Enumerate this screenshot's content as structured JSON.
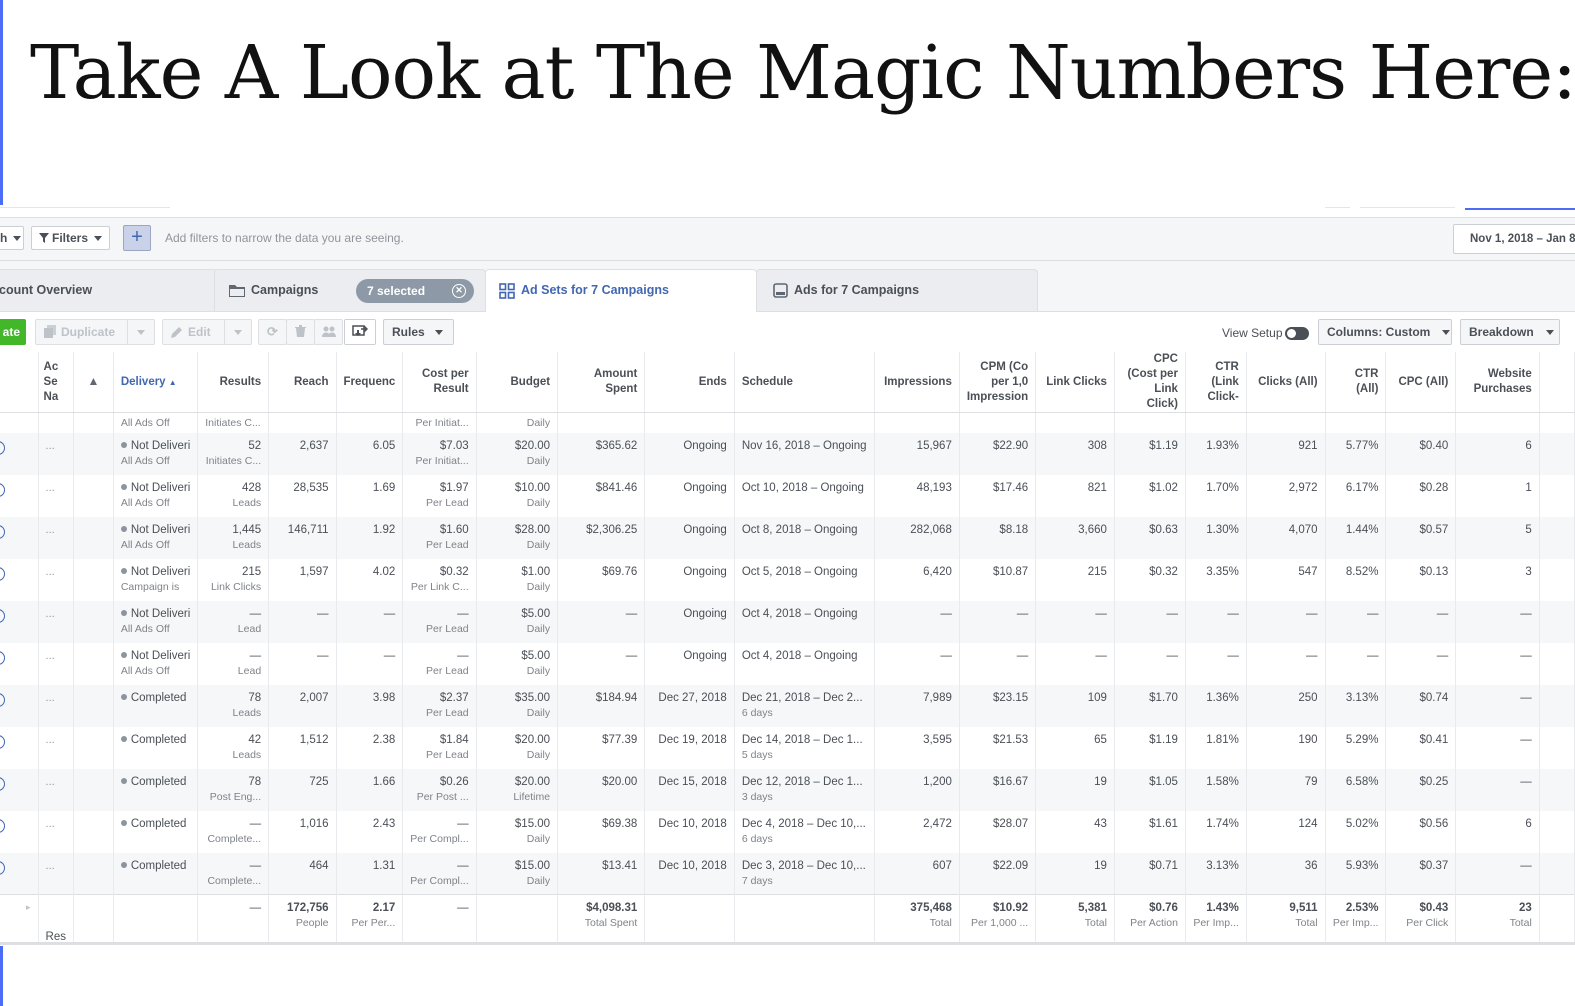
{
  "slide": {
    "title": "Take A Look at The Magic Numbers Here:"
  },
  "filterbar": {
    "search_caret_label": "h",
    "filters_label": "Filters",
    "add_label": "+",
    "hint": "Add filters to narrow the data you are seeing.",
    "date_range": "Nov 1, 2018 – Jan 8"
  },
  "tabs": {
    "account_overview": "count Overview",
    "campaigns": "Campaigns",
    "selected": "7 selected",
    "ad_sets": "Ad Sets for 7 Campaigns",
    "ads": "Ads for 7 Campaigns"
  },
  "toolbar": {
    "create_label": "ate",
    "duplicate_label": "Duplicate",
    "edit_label": "Edit",
    "rules_label": "Rules",
    "view_setup_label": "View Setup",
    "columns_label": "Columns: Custom",
    "breakdown_label": "Breakdown"
  },
  "columns": [
    "",
    "Ac Se Na",
    "",
    "Delivery",
    "Results",
    "Reach",
    "Frequenc",
    "Cost per Result",
    "Budget",
    "Amount Spent",
    "Ends",
    "Schedule",
    "Impressions",
    "CPM (Co per 1,0 Impression",
    "Link Clicks",
    "CPC (Cost per Link Click)",
    "CTR (Link Click-",
    "Clicks (All)",
    "CTR (All)",
    "CPC (All)",
    "Website Purchases"
  ],
  "partial_row": {
    "delivery_sub": "All Ads Off",
    "results_sub": "Initiates C...",
    "cpr_sub": "Per Initiat...",
    "budget_sub": "Daily"
  },
  "rows": [
    {
      "status": "Not Deliveri",
      "status_sub": "All Ads Off",
      "results": "52",
      "results_sub": "Initiates C...",
      "reach": "2,637",
      "frequency": "6.05",
      "cpr": "$7.03",
      "cpr_sub": "Per Initiat...",
      "budget": "$20.00",
      "budget_sub": "Daily",
      "spent": "$365.62",
      "ends": "Ongoing",
      "schedule": "Nov 16, 2018 – Ongoing",
      "schedule_sub": "",
      "impressions": "15,967",
      "cpm": "$22.90",
      "link_clicks": "308",
      "cpc_link": "$1.19",
      "ctr_link": "1.93%",
      "clicks_all": "921",
      "ctr_all": "5.77%",
      "cpc_all": "$0.40",
      "purchases": "6"
    },
    {
      "status": "Not Deliveri",
      "status_sub": "All Ads Off",
      "results": "428",
      "results_sub": "Leads",
      "reach": "28,535",
      "frequency": "1.69",
      "cpr": "$1.97",
      "cpr_sub": "Per Lead",
      "budget": "$10.00",
      "budget_sub": "Daily",
      "spent": "$841.46",
      "ends": "Ongoing",
      "schedule": "Oct 10, 2018 – Ongoing",
      "schedule_sub": "",
      "impressions": "48,193",
      "cpm": "$17.46",
      "link_clicks": "821",
      "cpc_link": "$1.02",
      "ctr_link": "1.70%",
      "clicks_all": "2,972",
      "ctr_all": "6.17%",
      "cpc_all": "$0.28",
      "purchases": "1"
    },
    {
      "status": "Not Deliveri",
      "status_sub": "All Ads Off",
      "results": "1,445",
      "results_sub": "Leads",
      "reach": "146,711",
      "frequency": "1.92",
      "cpr": "$1.60",
      "cpr_sub": "Per Lead",
      "budget": "$28.00",
      "budget_sub": "Daily",
      "spent": "$2,306.25",
      "ends": "Ongoing",
      "schedule": "Oct 8, 2018 – Ongoing",
      "schedule_sub": "",
      "impressions": "282,068",
      "cpm": "$8.18",
      "link_clicks": "3,660",
      "cpc_link": "$0.63",
      "ctr_link": "1.30%",
      "clicks_all": "4,070",
      "ctr_all": "1.44%",
      "cpc_all": "$0.57",
      "purchases": "5"
    },
    {
      "status": "Not Deliveri",
      "status_sub": "Campaign is",
      "results": "215",
      "results_sub": "Link Clicks",
      "reach": "1,597",
      "frequency": "4.02",
      "cpr": "$0.32",
      "cpr_sub": "Per Link C...",
      "budget": "$1.00",
      "budget_sub": "Daily",
      "spent": "$69.76",
      "ends": "Ongoing",
      "schedule": "Oct 5, 2018 – Ongoing",
      "schedule_sub": "",
      "impressions": "6,420",
      "cpm": "$10.87",
      "link_clicks": "215",
      "cpc_link": "$0.32",
      "ctr_link": "3.35%",
      "clicks_all": "547",
      "ctr_all": "8.52%",
      "cpc_all": "$0.13",
      "purchases": "3"
    },
    {
      "status": "Not Deliveri",
      "status_sub": "All Ads Off",
      "results": "—",
      "results_sub": "Lead",
      "reach": "—",
      "frequency": "—",
      "cpr": "—",
      "cpr_sub": "Per Lead",
      "budget": "$5.00",
      "budget_sub": "Daily",
      "spent": "—",
      "ends": "Ongoing",
      "schedule": "Oct 4, 2018 – Ongoing",
      "schedule_sub": "",
      "impressions": "—",
      "cpm": "—",
      "link_clicks": "—",
      "cpc_link": "—",
      "ctr_link": "—",
      "clicks_all": "—",
      "ctr_all": "—",
      "cpc_all": "—",
      "purchases": "—"
    },
    {
      "status": "Not Deliveri",
      "status_sub": "All Ads Off",
      "results": "—",
      "results_sub": "Lead",
      "reach": "—",
      "frequency": "—",
      "cpr": "—",
      "cpr_sub": "Per Lead",
      "budget": "$5.00",
      "budget_sub": "Daily",
      "spent": "—",
      "ends": "Ongoing",
      "schedule": "Oct 4, 2018 – Ongoing",
      "schedule_sub": "",
      "impressions": "—",
      "cpm": "—",
      "link_clicks": "—",
      "cpc_link": "—",
      "ctr_link": "—",
      "clicks_all": "—",
      "ctr_all": "—",
      "cpc_all": "—",
      "purchases": "—"
    },
    {
      "status": "Completed",
      "status_sub": "",
      "results": "78",
      "results_sub": "Leads",
      "reach": "2,007",
      "frequency": "3.98",
      "cpr": "$2.37",
      "cpr_sub": "Per Lead",
      "budget": "$35.00",
      "budget_sub": "Daily",
      "spent": "$184.94",
      "ends": "Dec 27, 2018",
      "schedule": "Dec 21, 2018 – Dec 2...",
      "schedule_sub": "6 days",
      "impressions": "7,989",
      "cpm": "$23.15",
      "link_clicks": "109",
      "cpc_link": "$1.70",
      "ctr_link": "1.36%",
      "clicks_all": "250",
      "ctr_all": "3.13%",
      "cpc_all": "$0.74",
      "purchases": "—"
    },
    {
      "status": "Completed",
      "status_sub": "",
      "results": "42",
      "results_sub": "Leads",
      "reach": "1,512",
      "frequency": "2.38",
      "cpr": "$1.84",
      "cpr_sub": "Per Lead",
      "budget": "$20.00",
      "budget_sub": "Daily",
      "spent": "$77.39",
      "ends": "Dec 19, 2018",
      "schedule": "Dec 14, 2018 – Dec 1...",
      "schedule_sub": "5 days",
      "impressions": "3,595",
      "cpm": "$21.53",
      "link_clicks": "65",
      "cpc_link": "$1.19",
      "ctr_link": "1.81%",
      "clicks_all": "190",
      "ctr_all": "5.29%",
      "cpc_all": "$0.41",
      "purchases": "—"
    },
    {
      "status": "Completed",
      "status_sub": "",
      "results": "78",
      "results_sub": "Post Eng...",
      "reach": "725",
      "frequency": "1.66",
      "cpr": "$0.26",
      "cpr_sub": "Per Post ...",
      "budget": "$20.00",
      "budget_sub": "Lifetime",
      "spent": "$20.00",
      "ends": "Dec 15, 2018",
      "schedule": "Dec 12, 2018 – Dec 1...",
      "schedule_sub": "3 days",
      "impressions": "1,200",
      "cpm": "$16.67",
      "link_clicks": "19",
      "cpc_link": "$1.05",
      "ctr_link": "1.58%",
      "clicks_all": "79",
      "ctr_all": "6.58%",
      "cpc_all": "$0.25",
      "purchases": "—"
    },
    {
      "status": "Completed",
      "status_sub": "",
      "results": "—",
      "results_sub": "Complete...",
      "reach": "1,016",
      "frequency": "2.43",
      "cpr": "—",
      "cpr_sub": "Per Compl...",
      "budget": "$15.00",
      "budget_sub": "Daily",
      "spent": "$69.38",
      "ends": "Dec 10, 2018",
      "schedule": "Dec 4, 2018 – Dec 10,...",
      "schedule_sub": "6 days",
      "impressions": "2,472",
      "cpm": "$28.07",
      "link_clicks": "43",
      "cpc_link": "$1.61",
      "ctr_link": "1.74%",
      "clicks_all": "124",
      "ctr_all": "5.02%",
      "cpc_all": "$0.56",
      "purchases": "6"
    },
    {
      "status": "Completed",
      "status_sub": "",
      "results": "—",
      "results_sub": "Complete...",
      "reach": "464",
      "frequency": "1.31",
      "cpr": "—",
      "cpr_sub": "Per Compl...",
      "budget": "$15.00",
      "budget_sub": "Daily",
      "spent": "$13.41",
      "ends": "Dec 10, 2018",
      "schedule": "Dec 3, 2018 – Dec 10,...",
      "schedule_sub": "7 days",
      "impressions": "607",
      "cpm": "$22.09",
      "link_clicks": "19",
      "cpc_link": "$0.71",
      "ctr_link": "3.13%",
      "clicks_all": "36",
      "ctr_all": "5.93%",
      "cpc_all": "$0.37",
      "purchases": "—"
    }
  ],
  "totals": {
    "label": "Res",
    "results": "—",
    "reach": "172,756",
    "reach_sub": "People",
    "frequency": "2.17",
    "frequency_sub": "Per Per...",
    "cpr": "—",
    "spent": "$4,098.31",
    "spent_sub": "Total Spent",
    "impressions": "375,468",
    "impressions_sub": "Total",
    "cpm": "$10.92",
    "cpm_sub": "Per 1,000 ...",
    "link_clicks": "5,381",
    "link_clicks_sub": "Total",
    "cpc_link": "$0.76",
    "cpc_link_sub": "Per Action",
    "ctr_link": "1.43%",
    "ctr_link_sub": "Per Imp...",
    "clicks_all": "9,511",
    "clicks_all_sub": "Total",
    "ctr_all": "2.53%",
    "ctr_all_sub": "Per Imp...",
    "cpc_all": "$0.43",
    "cpc_all_sub": "Per Click",
    "purchases": "23",
    "purchases_sub": "Total"
  }
}
